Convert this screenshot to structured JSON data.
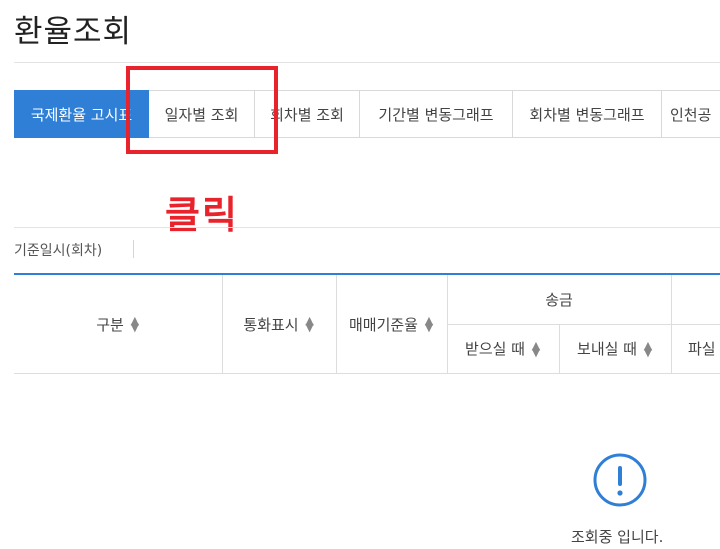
{
  "page": {
    "title": "환율조회"
  },
  "tabs": [
    {
      "label": "국제환율 고시표",
      "active": true
    },
    {
      "label": "일자별 조회",
      "active": false
    },
    {
      "label": "회차별 조회",
      "active": false
    },
    {
      "label": "기간별 변동그래프",
      "active": false
    },
    {
      "label": "회차별 변동그래프",
      "active": false
    },
    {
      "label": "인천공",
      "active": false
    }
  ],
  "annotation": {
    "text": "클릭",
    "color": "#e8232b"
  },
  "filter": {
    "date_label": "기준일시(회차)"
  },
  "table": {
    "headers": {
      "category": "구분",
      "currency": "통화표시",
      "base_rate": "매매기준율",
      "remittance": "송금",
      "receive": "받으실 때",
      "send": "보내실 때",
      "cut": "파실"
    }
  },
  "status": {
    "message": "조회중 입니다."
  },
  "colors": {
    "accent": "#2f7fd6",
    "annotation": "#e8232b"
  }
}
